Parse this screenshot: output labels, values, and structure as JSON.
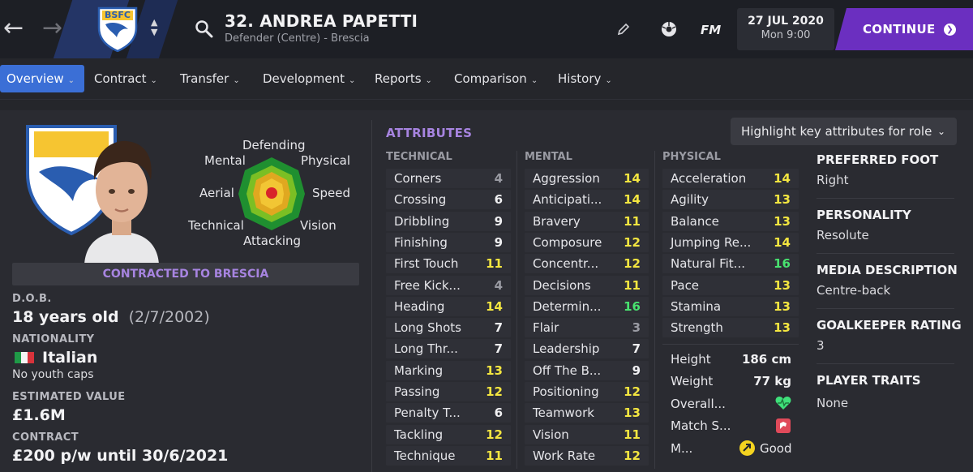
{
  "header": {
    "player_title": "32. ANDREA PAPETTI",
    "player_subtitle": "Defender (Centre) - Brescia",
    "club_badge_text": "BSFC",
    "fm_label": "FM",
    "date": "27 JUL 2020",
    "time": "Mon 9:00",
    "continue_label": "CONTINUE"
  },
  "tabs": [
    {
      "label": "Overview"
    },
    {
      "label": "Contract"
    },
    {
      "label": "Transfer"
    },
    {
      "label": "Development"
    },
    {
      "label": "Reports"
    },
    {
      "label": "Comparison"
    },
    {
      "label": "History"
    }
  ],
  "role_chart": {
    "labels": {
      "top": "Defending",
      "top_left": "Mental",
      "top_right": "Physical",
      "left": "Aerial",
      "right": "Speed",
      "bottom_left": "Technical",
      "bottom_right": "Vision",
      "bottom": "Attacking"
    }
  },
  "contract_banner": "CONTRACTED TO BRESCIA",
  "info": {
    "dob_label": "D.O.B.",
    "age": "18 years old",
    "dob": "(2/7/2002)",
    "nationality_label": "NATIONALITY",
    "nationality": "Italian",
    "youth_caps": "No youth caps",
    "value_label": "ESTIMATED VALUE",
    "value": "£1.6M",
    "contract_label": "CONTRACT",
    "contract": "£200 p/w until 30/6/2021"
  },
  "attributes": {
    "heading": "ATTRIBUTES",
    "highlight_label": "Highlight key attributes for role",
    "technical_label": "TECHNICAL",
    "mental_label": "MENTAL",
    "physical_label": "PHYSICAL",
    "technical": [
      {
        "name": "Corners",
        "value": "4",
        "tone": "grey"
      },
      {
        "name": "Crossing",
        "value": "6",
        "tone": "white"
      },
      {
        "name": "Dribbling",
        "value": "9",
        "tone": "white"
      },
      {
        "name": "Finishing",
        "value": "9",
        "tone": "white"
      },
      {
        "name": "First Touch",
        "value": "11",
        "tone": "yellow"
      },
      {
        "name": "Free Kick...",
        "value": "4",
        "tone": "grey"
      },
      {
        "name": "Heading",
        "value": "14",
        "tone": "yellow"
      },
      {
        "name": "Long Shots",
        "value": "7",
        "tone": "white"
      },
      {
        "name": "Long Thr...",
        "value": "7",
        "tone": "white"
      },
      {
        "name": "Marking",
        "value": "13",
        "tone": "yellow"
      },
      {
        "name": "Passing",
        "value": "12",
        "tone": "yellow"
      },
      {
        "name": "Penalty T...",
        "value": "6",
        "tone": "white"
      },
      {
        "name": "Tackling",
        "value": "12",
        "tone": "yellow"
      },
      {
        "name": "Technique",
        "value": "11",
        "tone": "yellow"
      }
    ],
    "mental": [
      {
        "name": "Aggression",
        "value": "14",
        "tone": "yellow"
      },
      {
        "name": "Anticipati...",
        "value": "14",
        "tone": "yellow"
      },
      {
        "name": "Bravery",
        "value": "11",
        "tone": "yellow"
      },
      {
        "name": "Composure",
        "value": "12",
        "tone": "yellow"
      },
      {
        "name": "Concentr...",
        "value": "12",
        "tone": "yellow"
      },
      {
        "name": "Decisions",
        "value": "11",
        "tone": "yellow"
      },
      {
        "name": "Determin...",
        "value": "16",
        "tone": "green"
      },
      {
        "name": "Flair",
        "value": "3",
        "tone": "grey"
      },
      {
        "name": "Leadership",
        "value": "7",
        "tone": "white"
      },
      {
        "name": "Off The B...",
        "value": "9",
        "tone": "white"
      },
      {
        "name": "Positioning",
        "value": "12",
        "tone": "yellow"
      },
      {
        "name": "Teamwork",
        "value": "13",
        "tone": "yellow"
      },
      {
        "name": "Vision",
        "value": "11",
        "tone": "yellow"
      },
      {
        "name": "Work Rate",
        "value": "12",
        "tone": "yellow"
      }
    ],
    "physical": [
      {
        "name": "Acceleration",
        "value": "14",
        "tone": "yellow"
      },
      {
        "name": "Agility",
        "value": "13",
        "tone": "yellow"
      },
      {
        "name": "Balance",
        "value": "13",
        "tone": "yellow"
      },
      {
        "name": "Jumping Re...",
        "value": "14",
        "tone": "yellow"
      },
      {
        "name": "Natural Fit...",
        "value": "16",
        "tone": "green"
      },
      {
        "name": "Pace",
        "value": "13",
        "tone": "yellow"
      },
      {
        "name": "Stamina",
        "value": "13",
        "tone": "yellow"
      },
      {
        "name": "Strength",
        "value": "13",
        "tone": "yellow"
      }
    ],
    "extras": {
      "height_label": "Height",
      "height": "186 cm",
      "weight_label": "Weight",
      "weight": "77 kg",
      "overall_label": "Overall...",
      "match_label": "Match S...",
      "morale_label": "M...",
      "morale_value": "Good"
    }
  },
  "right_panel": {
    "foot_label": "PREFERRED FOOT",
    "foot": "Right",
    "personality_label": "PERSONALITY",
    "personality": "Resolute",
    "media_label": "MEDIA DESCRIPTION",
    "media": "Centre-back",
    "gk_label": "GOALKEEPER RATING",
    "gk": "3",
    "traits_label": "PLAYER TRAITS",
    "traits": "None"
  },
  "colors": {
    "accent_purple": "#6b2fc0",
    "tab_active_blue": "#3b6fd6",
    "value_yellow": "#f4e640",
    "value_green": "#48e26f",
    "value_grey": "#9a9ba3"
  }
}
